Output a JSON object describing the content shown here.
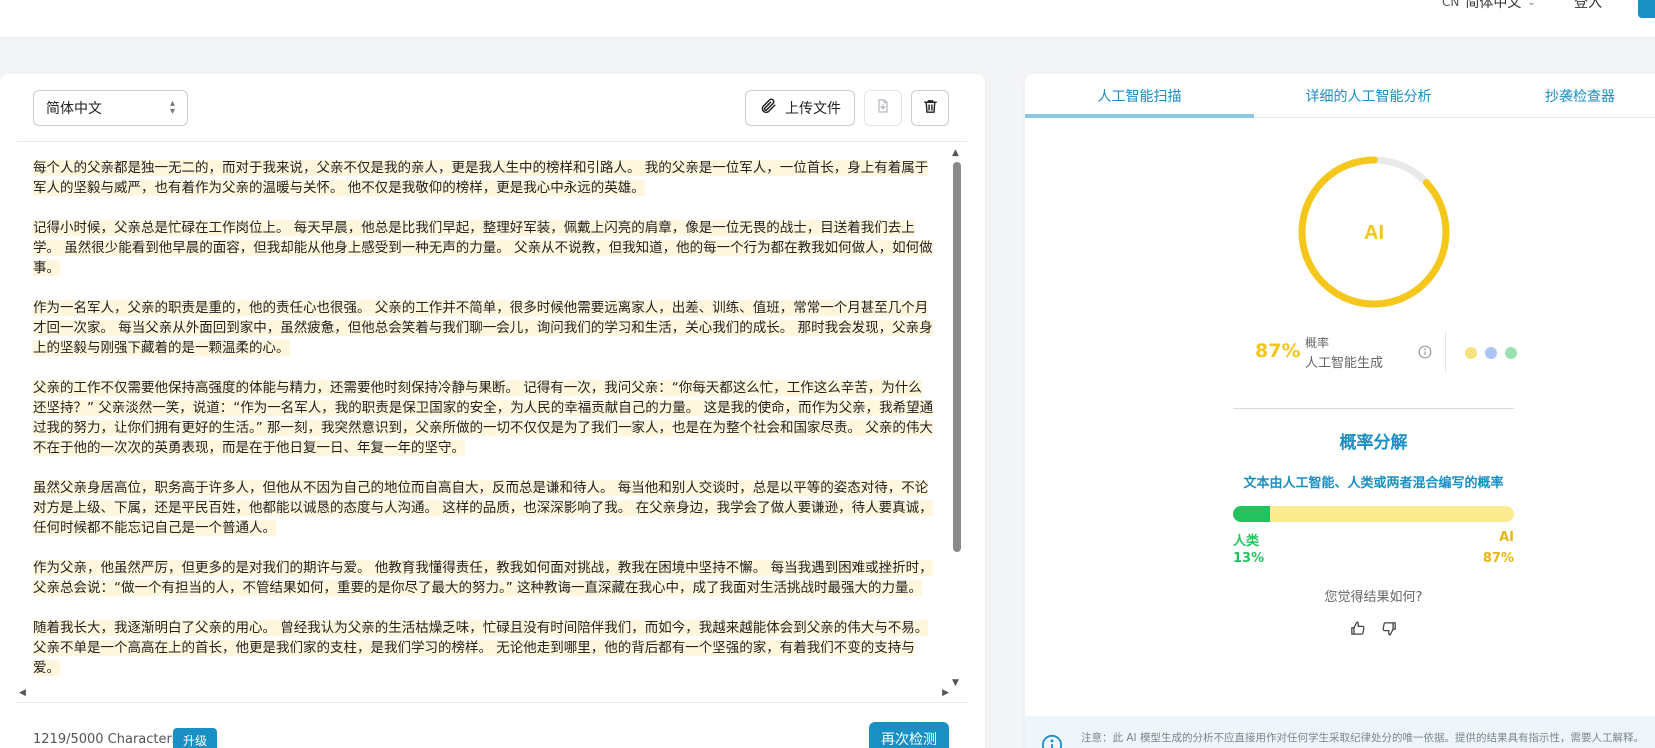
{
  "topbar": {
    "lang_code": "CN",
    "lang_label": "简体中文",
    "login": "登入"
  },
  "editor": {
    "language_select": "简体中文",
    "upload_label": "上传文件",
    "paragraphs": [
      "每个人的父亲都是独一无二的，而对于我来说，父亲不仅是我的亲人，更是我人生中的榜样和引路人。 我的父亲是一位军人，一位首长，身上有着属于军人的坚毅与威严，也有着作为父亲的温暖与关怀。 他不仅是我敬仰的榜样，更是我心中永远的英雄。",
      "记得小时候，父亲总是忙碌在工作岗位上。 每天早晨，他总是比我们早起，整理好军装，佩戴上闪亮的肩章，像是一位无畏的战士，目送着我们去上学。 虽然很少能看到他早晨的面容，但我却能从他身上感受到一种无声的力量。 父亲从不说教，但我知道，他的每一个行为都在教我如何做人，如何做事。",
      "作为一名军人，父亲的职责是重的，他的责任心也很强。 父亲的工作并不简单，很多时候他需要远离家人，出差、训练、值班，常常一个月甚至几个月才回一次家。 每当父亲从外面回到家中，虽然疲惫，但他总会笑着与我们聊一会儿，询问我们的学习和生活，关心我们的成长。 那时我会发现，父亲身上的坚毅与刚强下藏着的是一颗温柔的心。",
      "父亲的工作不仅需要他保持高强度的体能与精力，还需要他时刻保持冷静与果断。 记得有一次，我问父亲：“你每天都这么忙，工作这么辛苦，为什么还坚持？” 父亲淡然一笑，说道：“作为一名军人，我的职责是保卫国家的安全，为人民的幸福贡献自己的力量。 这是我的使命，而作为父亲，我希望通过我的努力，让你们拥有更好的生活。” 那一刻，我突然意识到，父亲所做的一切不仅仅是为了我们一家人，也是在为整个社会和国家尽责。 父亲的伟大不在于他的一次次的英勇表现，而是在于他日复一日、年复一年的坚守。",
      "虽然父亲身居高位，职务高于许多人，但他从不因为自己的地位而自高自大，反而总是谦和待人。 每当他和别人交谈时，总是以平等的姿态对待，不论对方是上级、下属，还是平民百姓，他都能以诚恳的态度与人沟通。 这样的品质，也深深影响了我。 在父亲身边，我学会了做人要谦逊，待人要真诚，任何时候都不能忘记自己是一个普通人。",
      "作为父亲，他虽然严厉，但更多的是对我们的期许与爱。 他教育我懂得责任，教我如何面对挑战，教我在困境中坚持不懈。 每当我遇到困难或挫折时，父亲总会说：“做一个有担当的人，不管结果如何，重要的是你尽了最大的努力。” 这种教诲一直深藏在我心中，成了我面对生活挑战时最强大的力量。",
      "随着我长大，我逐渐明白了父亲的用心。 曾经我认为父亲的生活枯燥乏味，忙碌且没有时间陪伴我们，而如今，我越来越能体会到父亲的伟大与不易。 父亲不单是一个高高在上的首长，他更是我们家的支柱，是我们学习的榜样。 无论他走到哪里，他的背后都有一个坚强的家，有着我们不变的支持与爱。"
    ],
    "char_count": "1219/5000 Characters",
    "upgrade_label": "升级",
    "recheck_label": "再次检测"
  },
  "results": {
    "tabs": [
      "人工智能扫描",
      "详细的人工智能分析",
      "抄袭检查器"
    ],
    "gauge_label": "AI",
    "ai_probability": 0.87,
    "ai_percent_text": "87%",
    "prob_label_1": "概率",
    "prob_label_2": "人工智能生成",
    "breakdown_title": "概率分解",
    "breakdown_subtitle": "文本由人工智能、人类或两者混合编写的概率",
    "human_fraction": 0.13,
    "human_label": "人类",
    "human_pct": "13%",
    "ai_label": "AI",
    "ai_pct": "87%",
    "feedback_question": "您觉得结果如何?",
    "notice": "注意：此 AI 模型生成的分析不应直接用作对任何学生采取纪律处分的唯一依据。提供的结果具有指示性，需要人工解释。"
  },
  "colors": {
    "accent": "#1a8fc4",
    "ai_yellow": "#f2c618",
    "human_green": "#22c35e",
    "highlight": "#fef7dd"
  }
}
